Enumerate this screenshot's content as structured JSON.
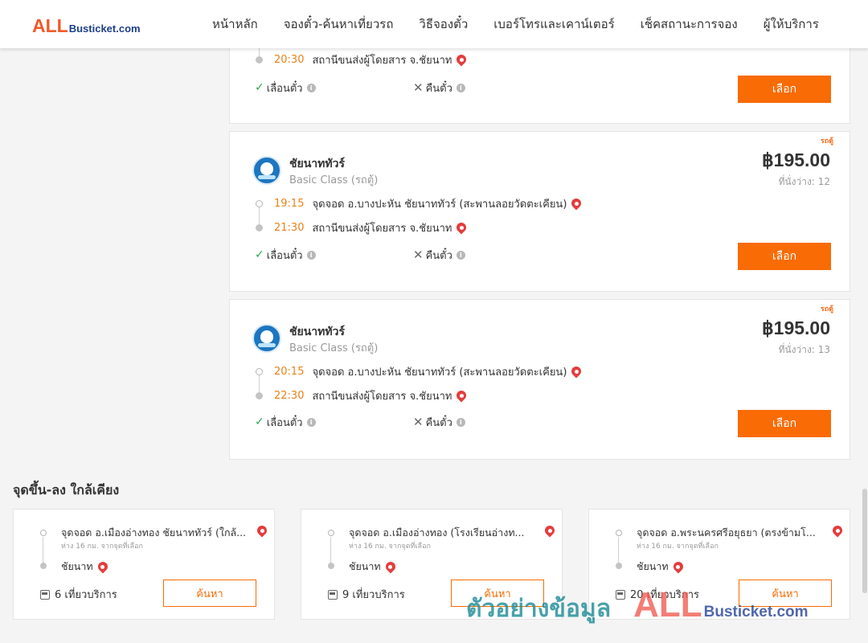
{
  "header": {
    "logo_all": "ALL",
    "logo_rest": "Busticket.com",
    "nav": [
      "หน้าหลัก",
      "จองตั๋ว-ค้นหาเที่ยวรถ",
      "วิธีจองตั๋ว",
      "เบอร์โทรและเคาน์เตอร์",
      "เช็คสถานะการจอง",
      "ผู้ให้บริการ"
    ]
  },
  "trips": [
    {
      "arrive_time": "20:30",
      "arrive_place": "สถานีขนส่งผู้โดยสาร จ.ชัยนาท",
      "reschedule": "เลื่อนตั๋ว",
      "refund": "คืนตั๋ว",
      "select_label": "เลือก"
    },
    {
      "tag": "รถตู้",
      "operator": "ชัยนาททัวร์",
      "bus_class": "Basic Class (รถตู้)",
      "price": "฿195.00",
      "seats": "ที่นั่งว่าง: 12",
      "depart_time": "19:15",
      "depart_place": "จุดจอด อ.บางปะหัน ชัยนาททัวร์ (สะพานลอยวัดตะเคียน)",
      "arrive_time": "21:30",
      "arrive_place": "สถานีขนส่งผู้โดยสาร จ.ชัยนาท",
      "reschedule": "เลื่อนตั๋ว",
      "refund": "คืนตั๋ว",
      "select_label": "เลือก"
    },
    {
      "tag": "รถตู้",
      "operator": "ชัยนาททัวร์",
      "bus_class": "Basic Class (รถตู้)",
      "price": "฿195.00",
      "seats": "ที่นั่งว่าง: 13",
      "depart_time": "20:15",
      "depart_place": "จุดจอด อ.บางปะหัน ชัยนาททัวร์ (สะพานลอยวัดตะเคียน)",
      "arrive_time": "22:30",
      "arrive_place": "สถานีขนส่งผู้โดยสาร จ.ชัยนาท",
      "reschedule": "เลื่อนตั๋ว",
      "refund": "คืนตั๋ว",
      "select_label": "เลือก"
    }
  ],
  "nearby": {
    "title": "จุดขึ้น-ลง ใกล้เคียง",
    "items": [
      {
        "from": "จุดจอด อ.เมืองอ่างทอง ชัยนาททัวร์ (ใกล้...",
        "distance": "ห่าง 16 กม. จากจุดที่เลือก",
        "to": "ชัยนาท",
        "trips": "6 เที่ยวบริการ",
        "search_label": "ค้นหา"
      },
      {
        "from": "จุดจอด อ.เมืองอ่างทอง (โรงเรียนอ่างท...",
        "distance": "ห่าง 16 กม. จากจุดที่เลือก",
        "to": "ชัยนาท",
        "trips": "9 เที่ยวบริการ",
        "search_label": "ค้นหา"
      },
      {
        "from": "จุดจอด อ.พระนครศรีอยุธยา (ตรงข้ามโ...",
        "distance": "ห่าง 16 กม. จากจุดที่เลือก",
        "to": "ชัยนาท",
        "trips": "20 เที่ยวบริการ",
        "search_label": "ค้นหา"
      }
    ]
  },
  "watermark": {
    "text": "ตัวอย่างข้อมูล",
    "logo_all": "ALL",
    "logo_rest": "Busticket.com"
  },
  "colors": {
    "accent": "#f96b04",
    "time": "#e9821a",
    "pin": "#e53c3c",
    "check": "#2ea64b"
  }
}
